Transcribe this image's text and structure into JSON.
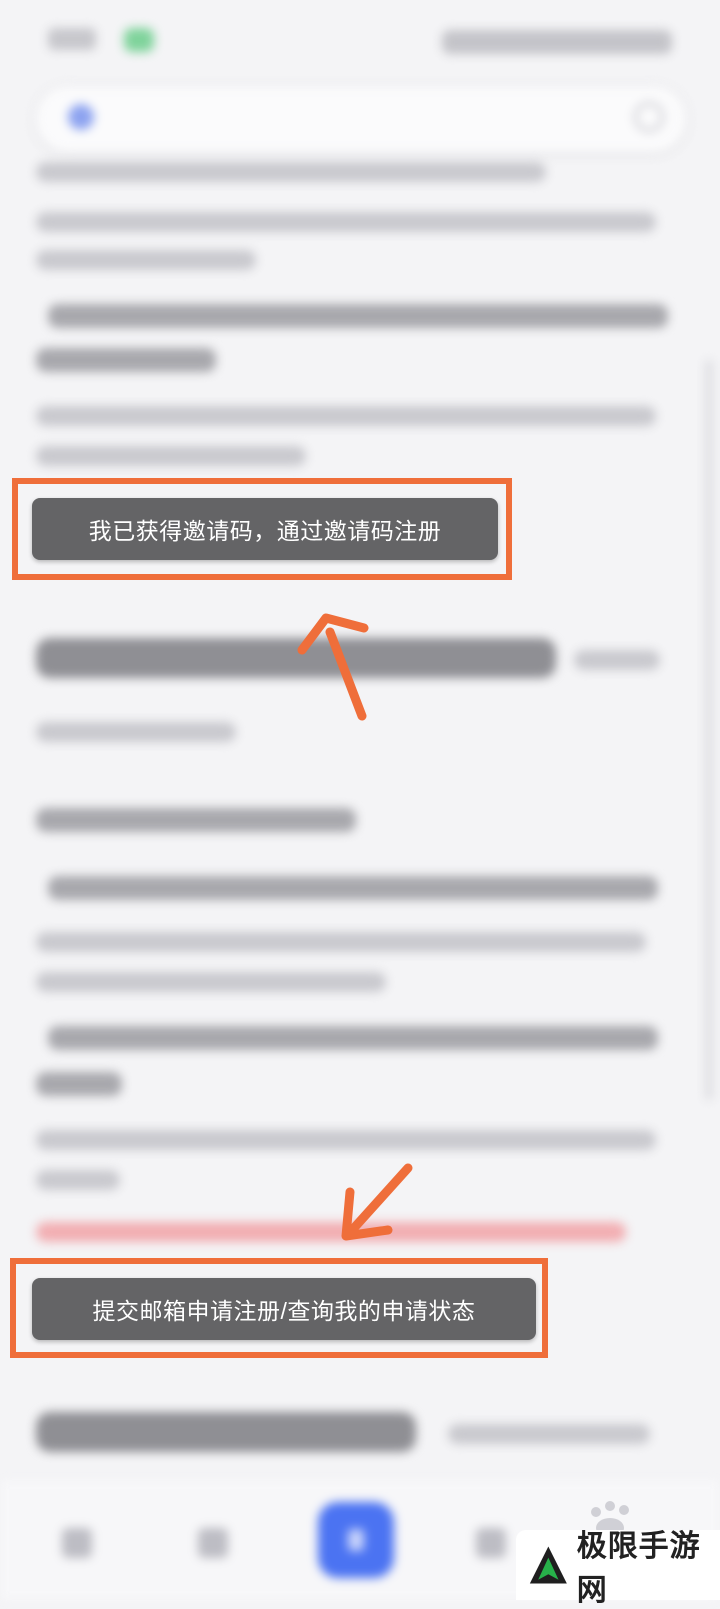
{
  "buttons": {
    "invite_register": "我已获得邀请码，通过邀请码注册",
    "email_apply": "提交邮箱申请注册/查询我的申请状态"
  },
  "watermark": {
    "logo_text": "极限手游网"
  },
  "colors": {
    "highlight_border": "#ef6e3a",
    "button_bg": "#646466",
    "nav_accent": "#4b73f2"
  },
  "icons": [
    "search-icon",
    "chevron-left-icon",
    "compose-icon",
    "home-icon",
    "tabs-icon",
    "arrow-icon"
  ]
}
